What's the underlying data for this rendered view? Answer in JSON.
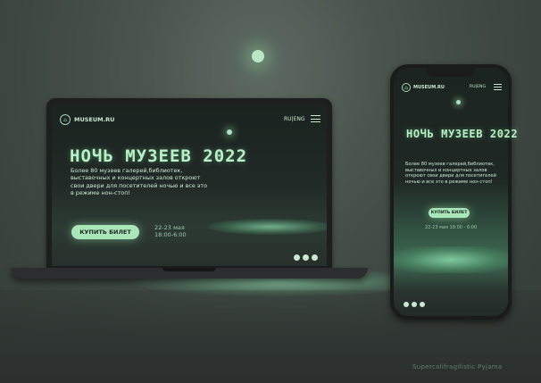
{
  "site": {
    "logo_text": "MUSEUM.RU",
    "lang": "RU|ENG",
    "title": "НОЧЬ МУЗЕЕВ 2022",
    "description_laptop": [
      "Более 80 музеев галерей,библиотек,",
      "выставочных и концертных залов откроют",
      "свои двери для посетителей ночью и все это",
      "в режиме нон-стоп!"
    ],
    "description_phone": [
      "Более 80 музеев галерей,библиотек,",
      "выставочных и концертных залов",
      "откроют свои двери для посетителей",
      "ночью и все это в режиме нон-стоп!"
    ],
    "buy_label": "КУПИТЬ БИЛЕТ",
    "date_line": "22-23 мая",
    "time_line": "18:00-6:00",
    "date_phone": "22-23 мая 18:00 - 6:00"
  },
  "icons": {
    "logo": "museum-logo-icon",
    "menu": "hamburger-menu-icon",
    "socials": [
      "whatsapp-icon",
      "telegram-icon",
      "youtube-icon"
    ]
  },
  "colors": {
    "accent": "#a9e6b8",
    "title": "#b6f2c4",
    "background": "#3e4742"
  },
  "footer": {
    "credit": "Supercalifragilistic Pyjama"
  }
}
